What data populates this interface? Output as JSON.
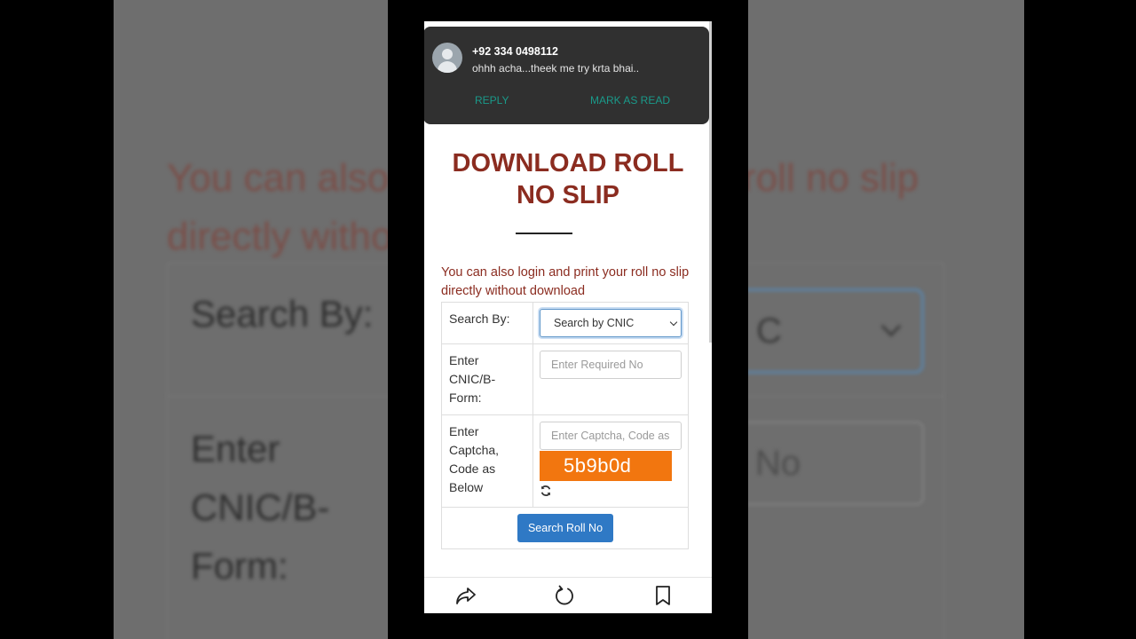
{
  "notification": {
    "sender": "+92 334 0498112",
    "message": "ohhh acha...theek me try krta bhai..",
    "actions": {
      "reply": "REPLY",
      "mark_read": "MARK AS READ"
    }
  },
  "page": {
    "title_line1": "DOWNLOAD ROLL",
    "title_line2": "NO SLIP",
    "intro": "You can also login and print your roll no slip directly without download"
  },
  "form": {
    "search_by_label": "Search By:",
    "search_by_value": "Search by CNIC",
    "cnic_label": "Enter CNIC/B-Form:",
    "cnic_placeholder": "Enter Required No",
    "captcha_label": "Enter Captcha, Code as Below",
    "captcha_placeholder": "Enter Captcha, Code as",
    "captcha_code": "5b9b0d",
    "submit_label": "Search Roll No"
  },
  "background": {
    "intro_text": "You can also login and print your roll no slip directly without download",
    "search_by_label": "Search By:",
    "cnic_label": "Enter CNIC/B-Form:",
    "select_fragment": "C",
    "input_fragment": "No"
  },
  "bottom_nav": {
    "icons": [
      "share-icon",
      "refresh-icon",
      "bookmark-icon"
    ]
  },
  "colors": {
    "title": "#8b2c20",
    "captcha_bg": "#f2760f",
    "button_bg": "#2f79c5",
    "notif_action": "#1a9a8a",
    "notif_bg": "#303030"
  }
}
